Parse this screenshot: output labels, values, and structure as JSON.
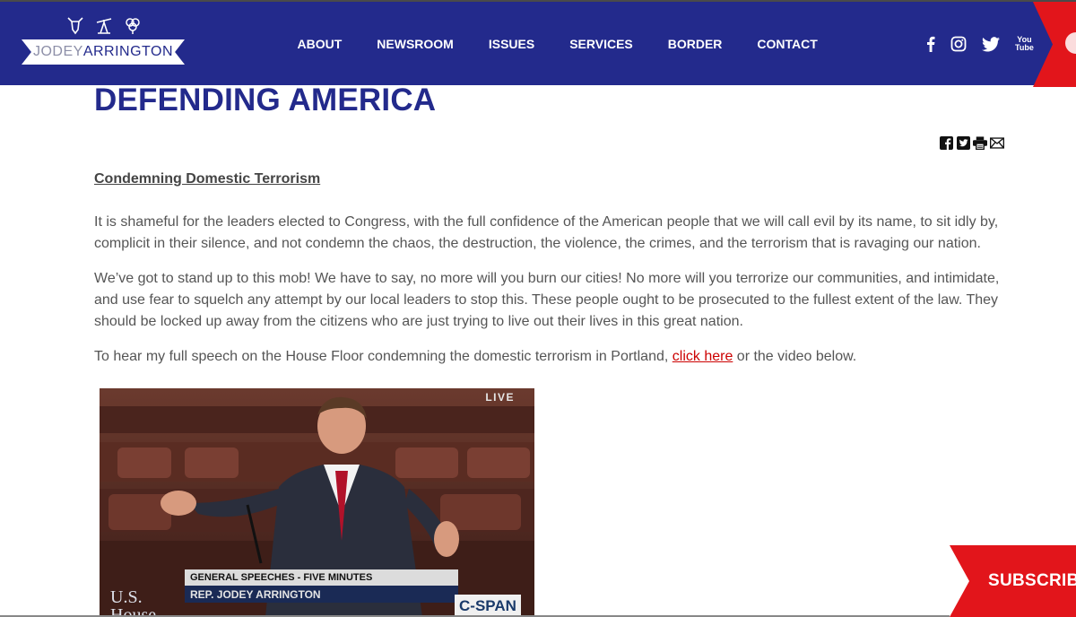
{
  "header": {
    "logo": {
      "first": "JODEY",
      "last": "ARRINGTON"
    },
    "nav": [
      "ABOUT",
      "NEWSROOM",
      "ISSUES",
      "SERVICES",
      "BORDER",
      "CONTACT"
    ],
    "social": {
      "youtube_top": "You",
      "youtube_bottom": "Tube"
    }
  },
  "page": {
    "title": "DEFENDING AMERICA",
    "section_heading": "Condemning Domestic Terrorism",
    "paragraphs": [
      "It is shameful for the leaders elected to Congress, with the full confidence of the American people that we will call evil by its name, to sit idly by, complicit in their silence, and not condemn the chaos, the destruction, the violence, the crimes, and the terrorism that is ravaging our nation.",
      "We’ve got to stand up to this mob! We have to say, no more will you burn our cities! No more will you terrorize our communities, and intimidate, and use fear to squelch any attempt by our local leaders to stop this. These people ought to be prosecuted to the fullest extent of the law. They should be locked up away from the citizens who are just trying to live out their lives in this great nation."
    ],
    "last_paragraph": {
      "before": "To hear my full speech on the House Floor condemning the domestic terrorism in Portland, ",
      "link": "click here",
      "after": " or the video below."
    }
  },
  "video": {
    "live": "LIVE",
    "lower_third_top": "GENERAL SPEECHES - FIVE MINUTES",
    "lower_third_bottom": "REP. JODEY ARRINGTON",
    "us_house_line1": "U.S.",
    "us_house_line2": "House",
    "network": "C-SPAN"
  },
  "subscribe": {
    "label": "SUBSCRIB"
  },
  "colors": {
    "navy": "#232a8c",
    "red": "#e2151b",
    "link": "#cc0000"
  }
}
